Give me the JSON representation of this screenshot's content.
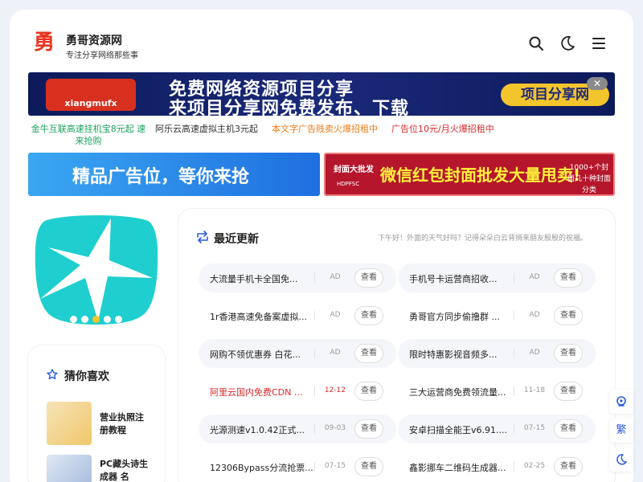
{
  "site": {
    "logo_char": "勇",
    "name": "勇哥资源网",
    "slogan": "专注分享网络那些事"
  },
  "header_icons": [
    "search-icon",
    "moon-icon",
    "menu-icon"
  ],
  "banner_top": {
    "logo_text": "xiangmufx",
    "line1": "免费网络资源项目分享",
    "line2": "来项目分享网免费发布、下载",
    "pill": "项目分享网",
    "close": "✕"
  },
  "text_ads": [
    {
      "text": "金牛互联高速挂机宝8元起 速来抢购",
      "color": "#1aa35c"
    },
    {
      "text": "阿乐云高速虚拟主机3元起",
      "color": "#333333"
    },
    {
      "text": "本文字广告贱卖火爆招租中",
      "color": "#f07c1a"
    },
    {
      "text": "广告位10元/月火爆招租中",
      "color": "#d92a2a"
    }
  ],
  "ad_left": {
    "text": "精品广告位，等你来抢"
  },
  "ad_right": {
    "tag": "封面大批发",
    "tag_sub": "HDPFSC",
    "headline": "微信红包封面批发大量甩卖!",
    "side": "1000+个封面几十种封面分类"
  },
  "slider": {
    "dots": 5,
    "active": 2
  },
  "guess": {
    "icon": "star-icon",
    "title": "猜你喜欢",
    "items": [
      {
        "title": "营业执照注册教程"
      },
      {
        "title": "PC藏头诗生成器 名"
      }
    ]
  },
  "recent": {
    "icon": "refresh-icon",
    "title": "最近更新",
    "greeting": "下午好！外面的天气好吗？记得朵朵白云背捎来朋友殷殷的祝福。",
    "button_label": "查看",
    "left": [
      {
        "title": "大流量手机卡全国免...",
        "meta": "AD",
        "highlight": false
      },
      {
        "title": "1r香港高速免备案虚拟...",
        "meta": "AD",
        "highlight": false
      },
      {
        "title": "网购不领优惠券 白花...",
        "meta": "AD",
        "highlight": false
      },
      {
        "title": "阿里云国内免费CDN ...",
        "meta": "12-12",
        "highlight": true
      },
      {
        "title": "光源测速v1.0.42正式...",
        "meta": "09-03",
        "highlight": false
      },
      {
        "title": "12306Bypass分流抢票...",
        "meta": "07-15",
        "highlight": false
      }
    ],
    "right": [
      {
        "title": "手机号卡运营商招收...",
        "meta": "AD",
        "highlight": false
      },
      {
        "title": "勇哥官方同步偷撸群 ...",
        "meta": "AD",
        "highlight": false
      },
      {
        "title": "限时特惠影视音频多...",
        "meta": "AD",
        "highlight": false
      },
      {
        "title": "三大运营商免费领流量...",
        "meta": "11-18",
        "highlight": false
      },
      {
        "title": "安卓扫描全能王v6.91....",
        "meta": "07-15",
        "highlight": false
      },
      {
        "title": "鑫影挪车二维码生成器...",
        "meta": "02-25",
        "highlight": false
      }
    ]
  },
  "float_bar": [
    {
      "icon": "support-icon",
      "label": ""
    },
    {
      "icon": "traditional-chinese-icon",
      "label": "繁"
    },
    {
      "icon": "moon-icon",
      "label": ""
    }
  ],
  "colors": {
    "accent": "#2c5be0",
    "brand_red": "#e8331e",
    "highlight_red": "#d92a2a",
    "slider_cyan": "#1fcfcf"
  }
}
